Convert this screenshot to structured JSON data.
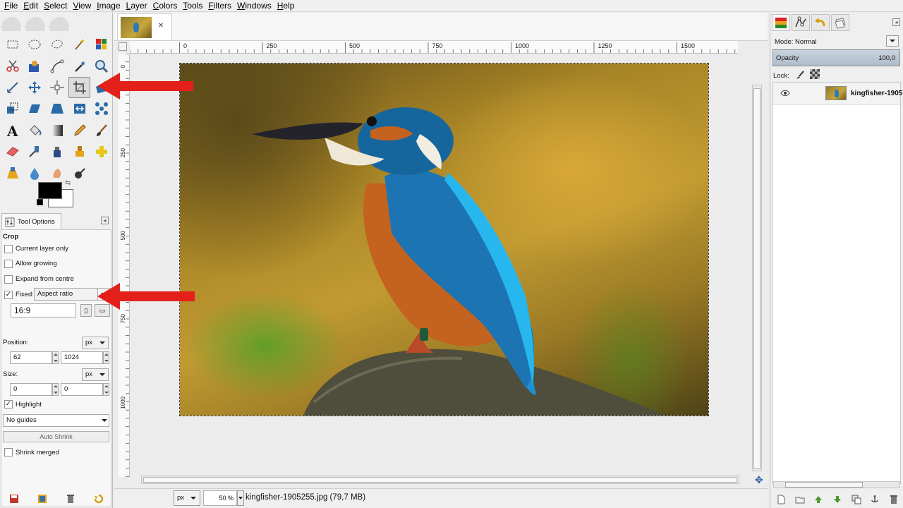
{
  "menubar": [
    "File",
    "Edit",
    "Select",
    "View",
    "Image",
    "Layer",
    "Colors",
    "Tools",
    "Filters",
    "Windows",
    "Help"
  ],
  "toolbox": {
    "tools": [
      "rect-select",
      "ellipse-select",
      "free-select",
      "fuzzy-select",
      "select-by-color",
      "scissors-select",
      "foreground-select",
      "paths",
      "color-picker",
      "zoom",
      "measure",
      "move",
      "alignment",
      "crop",
      "rotate",
      "scale",
      "shear",
      "perspective",
      "flip",
      "cage-transform",
      "text",
      "bucket-fill",
      "blend",
      "pencil",
      "paintbrush",
      "eraser",
      "airbrush",
      "ink",
      "clone",
      "heal",
      "perspective-clone",
      "blur",
      "smudge",
      "dodge-burn"
    ],
    "active_tool": "crop",
    "fg_color": "#000000",
    "bg_color": "#ffffff"
  },
  "tool_options": {
    "tab_label": "Tool Options",
    "heading": "Crop",
    "current_layer_only": "Current layer only",
    "allow_growing": "Allow growing",
    "expand_from_centre": "Expand from centre",
    "fixed_label": "Fixed:",
    "fixed_value": "Aspect ratio",
    "ratio_value": "16:9",
    "position_label": "Position:",
    "position_unit": "px",
    "position_x": "62",
    "position_y": "1024",
    "size_label": "Size:",
    "size_unit": "px",
    "size_w": "0",
    "size_h": "0",
    "highlight": "Highlight",
    "guides": "No guides",
    "auto_shrink": "Auto Shrink",
    "shrink_merged": "Shrink merged"
  },
  "ruler": {
    "h_labels": [
      "0",
      "250",
      "500",
      "750",
      "1000",
      "1250",
      "1500"
    ],
    "v_labels": [
      "0",
      "250",
      "500",
      "750",
      "1000"
    ]
  },
  "status": {
    "unit": "px",
    "zoom": "50 %",
    "file_info": "kingfisher-1905255.jpg (79,7 MB)"
  },
  "layers": {
    "mode_label": "Mode: Normal",
    "opacity_label": "Opacity",
    "opacity_value": "100,0",
    "lock_label": "Lock:",
    "layer_name": "kingfisher-1905"
  },
  "colors": {
    "annotation_arrow": "#e3201a",
    "kingfisher_blue": "#1f8fd2",
    "kingfisher_orange": "#c4621f"
  }
}
